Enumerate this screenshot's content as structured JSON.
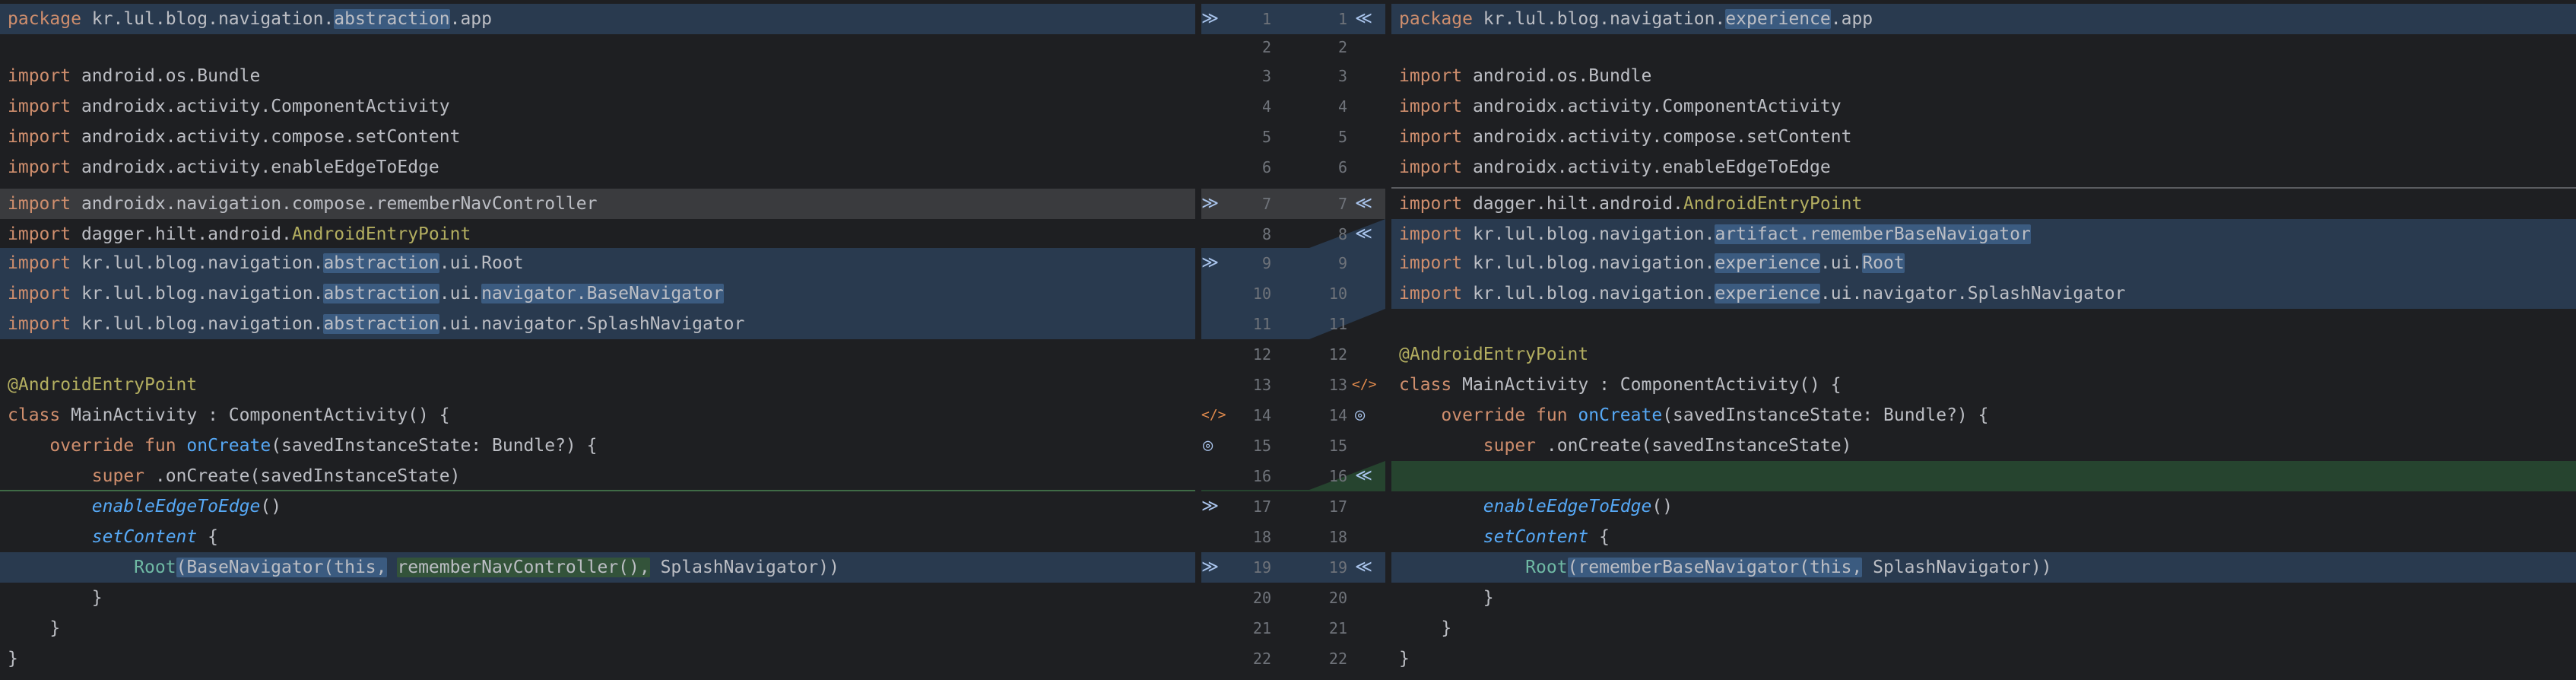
{
  "left": {
    "lines": [
      {
        "num": "1",
        "tokens": [
          [
            "kw",
            "package"
          ],
          [
            "",
            "kr.lul.blog.navigation."
          ],
          [
            "hl",
            "abstraction"
          ],
          [
            "",
            ".app"
          ]
        ]
      },
      {
        "num": "2",
        "tokens": []
      },
      {
        "num": "3",
        "tokens": [
          [
            "kw",
            "import"
          ],
          [
            "",
            "android.os.Bundle"
          ]
        ]
      },
      {
        "num": "4",
        "tokens": [
          [
            "kw",
            "import"
          ],
          [
            "",
            "androidx.activity.ComponentActivity"
          ]
        ]
      },
      {
        "num": "5",
        "tokens": [
          [
            "kw",
            "import"
          ],
          [
            "",
            "androidx.activity.compose.setContent"
          ]
        ]
      },
      {
        "num": "6",
        "tokens": [
          [
            "kw",
            "import"
          ],
          [
            "",
            "androidx.activity.enableEdgeToEdge"
          ]
        ]
      },
      {
        "num": "7",
        "tokens": [
          [
            "kw",
            "import"
          ],
          [
            "",
            "androidx.navigation.compose.rememberNavController"
          ]
        ]
      },
      {
        "num": "8",
        "tokens": [
          [
            "kw",
            "import"
          ],
          [
            "",
            "dagger.hilt.android."
          ],
          [
            "ann",
            "AndroidEntryPoint"
          ]
        ]
      },
      {
        "num": "9",
        "tokens": [
          [
            "kw",
            "import"
          ],
          [
            "",
            "kr.lul.blog.navigation."
          ],
          [
            "hl",
            "abstraction"
          ],
          [
            "",
            ".ui.Root"
          ]
        ]
      },
      {
        "num": "10",
        "tokens": [
          [
            "kw",
            "import"
          ],
          [
            "",
            "kr.lul.blog.navigation."
          ],
          [
            "hl",
            "abstraction"
          ],
          [
            "",
            ".ui."
          ],
          [
            "hl",
            "navigator.BaseNavigator"
          ]
        ]
      },
      {
        "num": "11",
        "tokens": [
          [
            "kw",
            "import"
          ],
          [
            "",
            "kr.lul.blog.navigation."
          ],
          [
            "hl",
            "abstraction"
          ],
          [
            "",
            ".ui.navigator.SplashNavigator"
          ]
        ]
      },
      {
        "num": "12",
        "tokens": []
      },
      {
        "num": "13",
        "tokens": [
          [
            "ann",
            "@AndroidEntryPoint"
          ]
        ]
      },
      {
        "num": "14",
        "tokens": [
          [
            "kw",
            "class"
          ],
          [
            "",
            "MainActivity : ComponentActivity() {"
          ]
        ]
      },
      {
        "num": "15",
        "tokens": [
          [
            "",
            "    "
          ],
          [
            "kw",
            "override fun"
          ],
          [
            "",
            " "
          ],
          [
            "fn",
            "onCreate"
          ],
          [
            "",
            "(savedInstanceState: Bundle?) {"
          ]
        ]
      },
      {
        "num": "16",
        "tokens": [
          [
            "",
            "        "
          ],
          [
            "kw",
            "super"
          ],
          [
            "",
            ".onCreate(savedInstanceState)"
          ]
        ]
      },
      {
        "num": "17",
        "tokens": [
          [
            "",
            "        "
          ],
          [
            "it",
            "enableEdgeToEdge"
          ],
          [
            "",
            "()"
          ]
        ]
      },
      {
        "num": "18",
        "tokens": [
          [
            "",
            "        "
          ],
          [
            "it",
            "setContent"
          ],
          [
            "",
            " {"
          ]
        ]
      },
      {
        "num": "19",
        "tokens": [
          [
            "",
            "            "
          ],
          [
            "cl",
            "Root"
          ],
          [
            "hl",
            "(BaseNavigator(this,"
          ],
          [
            "",
            " "
          ],
          [
            "hl-g",
            "rememberNavController(),"
          ],
          [
            "",
            " SplashNavigator))"
          ]
        ]
      },
      {
        "num": "20",
        "tokens": [
          [
            "",
            "        }"
          ]
        ]
      },
      {
        "num": "21",
        "tokens": [
          [
            "",
            "    }"
          ]
        ]
      },
      {
        "num": "22",
        "tokens": [
          [
            "",
            "}"
          ]
        ]
      }
    ]
  },
  "right": {
    "lines": [
      {
        "num": "1",
        "tokens": [
          [
            "kw",
            "package"
          ],
          [
            "",
            "kr.lul.blog.navigation."
          ],
          [
            "hl",
            "experience"
          ],
          [
            "",
            ".app"
          ]
        ]
      },
      {
        "num": "2",
        "tokens": []
      },
      {
        "num": "3",
        "tokens": [
          [
            "kw",
            "import"
          ],
          [
            "",
            "android.os.Bundle"
          ]
        ]
      },
      {
        "num": "4",
        "tokens": [
          [
            "kw",
            "import"
          ],
          [
            "",
            "androidx.activity.ComponentActivity"
          ]
        ]
      },
      {
        "num": "5",
        "tokens": [
          [
            "kw",
            "import"
          ],
          [
            "",
            "androidx.activity.compose.setContent"
          ]
        ]
      },
      {
        "num": "6",
        "tokens": [
          [
            "kw",
            "import"
          ],
          [
            "",
            "androidx.activity.enableEdgeToEdge"
          ]
        ]
      },
      {
        "num": "7",
        "tokens": [
          [
            "kw",
            "import"
          ],
          [
            "",
            "dagger.hilt.android."
          ],
          [
            "ann",
            "AndroidEntryPoint"
          ]
        ]
      },
      {
        "num": "8",
        "tokens": [
          [
            "kw",
            "import"
          ],
          [
            "",
            "kr.lul.blog.navigation."
          ],
          [
            "hl",
            "artifact.rememberBaseNavigator"
          ]
        ]
      },
      {
        "num": "9",
        "tokens": [
          [
            "kw",
            "import"
          ],
          [
            "",
            "kr.lul.blog.navigation."
          ],
          [
            "hl",
            "experience"
          ],
          [
            "",
            ".ui."
          ],
          [
            "hl",
            "Root"
          ]
        ]
      },
      {
        "num": "10",
        "tokens": [
          [
            "kw",
            "import"
          ],
          [
            "",
            "kr.lul.blog.navigation."
          ],
          [
            "hl",
            "experience"
          ],
          [
            "",
            ".ui.navigator.SplashNavigator"
          ]
        ]
      },
      {
        "num": "11",
        "tokens": []
      },
      {
        "num": "12",
        "tokens": [
          [
            "ann",
            "@AndroidEntryPoint"
          ]
        ]
      },
      {
        "num": "13",
        "tokens": [
          [
            "kw",
            "class"
          ],
          [
            "",
            "MainActivity : ComponentActivity() {"
          ]
        ]
      },
      {
        "num": "14",
        "tokens": [
          [
            "",
            "    "
          ],
          [
            "kw",
            "override fun"
          ],
          [
            "",
            " "
          ],
          [
            "fn",
            "onCreate"
          ],
          [
            "",
            "(savedInstanceState: Bundle?) {"
          ]
        ]
      },
      {
        "num": "15",
        "tokens": [
          [
            "",
            "        "
          ],
          [
            "kw",
            "super"
          ],
          [
            "",
            ".onCreate(savedInstanceState)"
          ]
        ]
      },
      {
        "num": "16",
        "tokens": []
      },
      {
        "num": "17",
        "tokens": [
          [
            "",
            "        "
          ],
          [
            "it",
            "enableEdgeToEdge"
          ],
          [
            "",
            "()"
          ]
        ]
      },
      {
        "num": "18",
        "tokens": [
          [
            "",
            "        "
          ],
          [
            "it",
            "setContent"
          ],
          [
            "",
            " {"
          ]
        ]
      },
      {
        "num": "19",
        "tokens": [
          [
            "",
            "            "
          ],
          [
            "cl",
            "Root"
          ],
          [
            "hl",
            "(rememberBaseNavigator(this,"
          ],
          [
            "",
            " SplashNavigator))"
          ]
        ]
      },
      {
        "num": "20",
        "tokens": [
          [
            "",
            "        }"
          ]
        ]
      },
      {
        "num": "21",
        "tokens": [
          [
            "",
            "    }"
          ]
        ]
      },
      {
        "num": "22",
        "tokens": [
          [
            "",
            "}"
          ]
        ]
      }
    ]
  },
  "gutter": {
    "left_numbers": [
      "1",
      "2",
      "3",
      "4",
      "5",
      "6",
      "7",
      "8",
      "9",
      "10",
      "11",
      "12",
      "13",
      "14",
      "15",
      "16",
      "17",
      "18",
      "19",
      "20",
      "21",
      "22"
    ],
    "right_numbers": [
      "1",
      "2",
      "3",
      "4",
      "5",
      "6",
      "7",
      "8",
      "9",
      "10",
      "11",
      "12",
      "13",
      "14",
      "15",
      "16",
      "17",
      "18",
      "19",
      "20",
      "21",
      "22"
    ],
    "apply_left_icon": "double-chevron-right-icon",
    "apply_right_icon": "double-chevron-left-icon",
    "chevron_right_glyph": "≫",
    "chevron_left_glyph": "≪",
    "code_icon_glyph": "</>",
    "target_icon_glyph": "◎"
  },
  "colors": {
    "background": "#1e1f22",
    "modified_bg": "#293a4f",
    "deleted_bg": "#3a3b3e",
    "inserted_bg": "#26442f",
    "highlight": "#3b5b80",
    "keyword": "#cf8e6d",
    "annotation": "#b3ae60",
    "function": "#56a8f5"
  }
}
